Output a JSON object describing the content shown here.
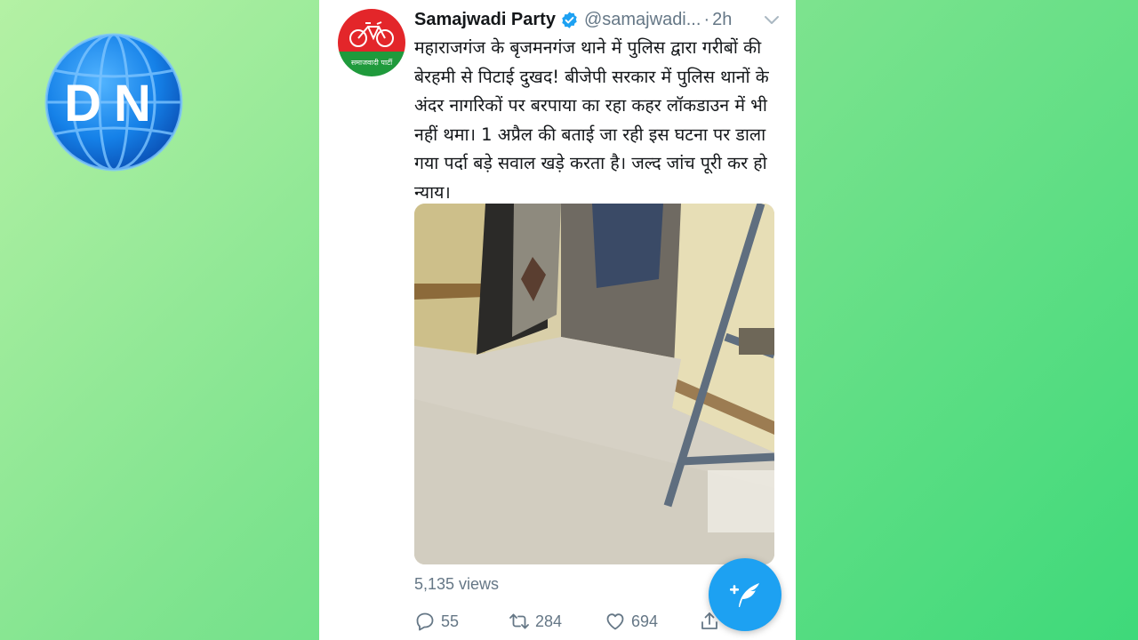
{
  "logo": {
    "letters": "DN"
  },
  "tweet": {
    "author": {
      "display_name": "Samajwadi Party",
      "handle": "@samajwadi...",
      "avatar_caption": "समाजवादी पार्टी",
      "verified": true
    },
    "separator": "·",
    "time": "2h",
    "text": "महाराजगंज के बृजमनगंज थाने में पुलिस द्वारा गरीबों की बेरहमी से पिटाई दुखद! बीजेपी सरकार में पुलिस थानों के अंदर नागरिकों पर बरपाया का रहा कहर लॉकडाउन में भी नहीं थमा। 1 अप्रैल की बताई जा रही इस घटना पर डाला गया पर्दा बड़े सवाल खड़े करता है। जल्द जांच पूरी कर हो न्याय।",
    "views": "5,135 views",
    "actions": {
      "replies": "55",
      "retweets": "284",
      "likes": "694"
    }
  },
  "icons": {
    "verified": "verified-badge-icon",
    "chevron": "chevron-down-icon",
    "reply": "reply-icon",
    "retweet": "retweet-icon",
    "like": "heart-icon",
    "share": "share-icon",
    "compose": "compose-tweet-icon"
  },
  "colors": {
    "accent": "#1da1f2",
    "party_red": "#e3262a",
    "party_green": "#1f9a3c",
    "text": "#14171a",
    "muted": "#657786"
  }
}
